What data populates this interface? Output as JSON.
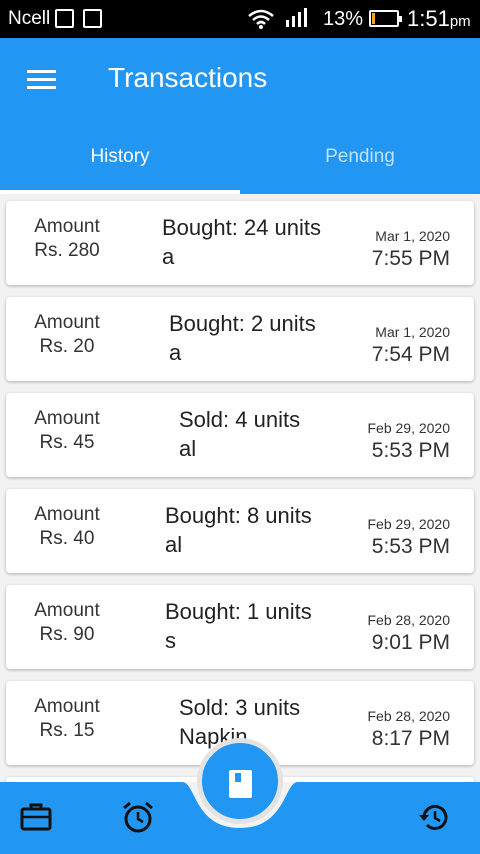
{
  "status_bar": {
    "carrier": "Ncell",
    "battery_percent": "13%",
    "battery_level": 0.13,
    "time": "1:51",
    "time_suffix": "pm",
    "icons": [
      "sim-map-icon",
      "image-icon",
      "wifi-icon",
      "signal-icon",
      "battery-icon"
    ]
  },
  "app_bar": {
    "title": "Transactions",
    "menu_icon": "menu-icon"
  },
  "tabs": [
    {
      "label": "History",
      "selected": true
    },
    {
      "label": "Pending",
      "selected": false
    }
  ],
  "transactions": [
    {
      "amount_label": "Amount",
      "amount": "Rs. 280",
      "desc_line1": "Bought: 24 units",
      "desc_line2": "a",
      "date": "Mar 1, 2020",
      "time": "7:55 PM"
    },
    {
      "amount_label": "Amount",
      "amount": "Rs. 20",
      "desc_line1": "Bought: 2 units",
      "desc_line2": "a",
      "date": "Mar 1, 2020",
      "time": "7:54 PM"
    },
    {
      "amount_label": "Amount",
      "amount": "Rs. 45",
      "desc_line1": "Sold: 4 units",
      "desc_line2": "al",
      "date": "Feb 29, 2020",
      "time": "5:53 PM"
    },
    {
      "amount_label": "Amount",
      "amount": "Rs. 40",
      "desc_line1": "Bought: 8 units",
      "desc_line2": "al",
      "date": "Feb 29, 2020",
      "time": "5:53 PM"
    },
    {
      "amount_label": "Amount",
      "amount": "Rs. 90",
      "desc_line1": "Bought: 1 units",
      "desc_line2": "s",
      "date": "Feb 28, 2020",
      "time": "9:01 PM"
    },
    {
      "amount_label": "Amount",
      "amount": "Rs. 15",
      "desc_line1": "Sold: 3 units",
      "desc_line2": "Napkin",
      "date": "Feb 28, 2020",
      "time": "8:17 PM"
    }
  ],
  "bottom_nav": {
    "items": [
      "briefcase-icon",
      "alarm-clock-icon",
      "history-icon"
    ],
    "fab_icon": "book-icon"
  },
  "colors": {
    "primary": "#2196f3",
    "background": "#f2f2f2",
    "status_bar": "#000000"
  }
}
